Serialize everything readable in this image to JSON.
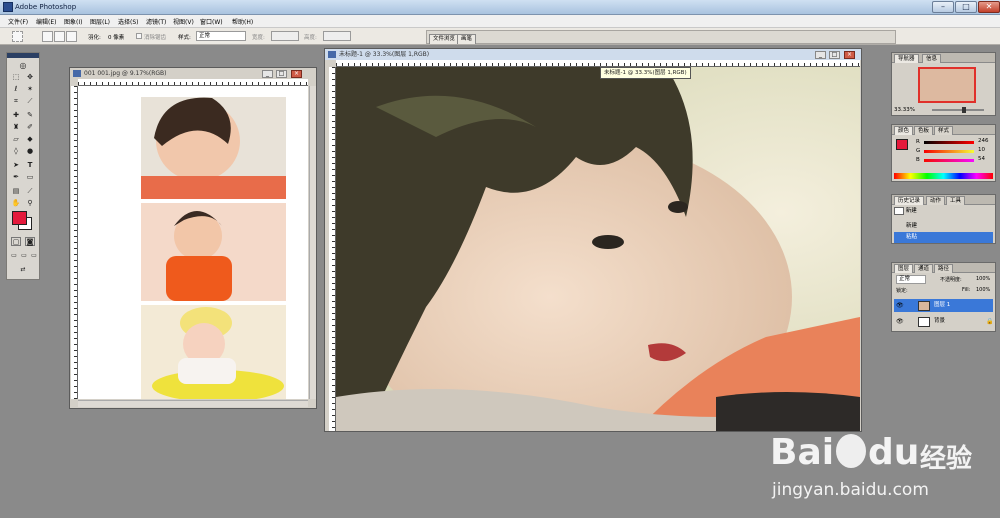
{
  "app": {
    "title": "Adobe Photoshop"
  },
  "window_controls": {
    "minimize": "–",
    "maximize": "□",
    "close": "✕"
  },
  "menu": {
    "items": [
      "文件(F)",
      "编辑(E)",
      "图象(I)",
      "图层(L)",
      "选择(S)",
      "滤镜(T)",
      "视图(V)",
      "窗口(W)",
      "帮助(H)"
    ]
  },
  "options": {
    "feather_label": "羽化:",
    "feather_value": "0 像素",
    "antialias_label": "消除锯齿",
    "style_label": "样式:",
    "style_value": "正常",
    "width_label": "宽度:",
    "height_label": "高度:"
  },
  "wells": {
    "file_browser": "文件浏览",
    "brushes": "画笔"
  },
  "docs": {
    "left": {
      "title": "001 001.jpg @ 9.17%(RGB)"
    },
    "main": {
      "title": "未标题-1 @ 33.3%(图层 1,RGB)",
      "tooltip": "未标题-1 @ 33.3%(图层 1,RGB)"
    }
  },
  "colors": {
    "foreground": "#e41a3c",
    "background": "#ffffff",
    "accent": "#3a78d8",
    "swatch": "#f6103a"
  },
  "navigator": {
    "tabs": [
      "导航器",
      "信息"
    ],
    "zoom": "33.33%"
  },
  "color_panel": {
    "tabs": [
      "颜色",
      "色板",
      "样式"
    ],
    "r_label": "R",
    "r_value": "246",
    "g_label": "G",
    "g_value": "10",
    "b_label": "B",
    "b_value": "54"
  },
  "history_panel": {
    "tabs": [
      "历史记录",
      "动作",
      "工具"
    ],
    "snapshot": "新建",
    "items": [
      "新建",
      "粘贴"
    ]
  },
  "layers_panel": {
    "tabs": [
      "图层",
      "通道",
      "路径"
    ],
    "mode": "正常",
    "opacity_label": "不透明度:",
    "opacity_value": "100%",
    "lock_label": "锁定:",
    "fill_label": "Fill:",
    "fill_value": "100%",
    "layers": [
      "图层 1",
      "背景"
    ]
  },
  "watermark": {
    "brand": "Bai",
    "brand2": "du",
    "cn": "经验",
    "url": "jingyan.baidu.com"
  }
}
